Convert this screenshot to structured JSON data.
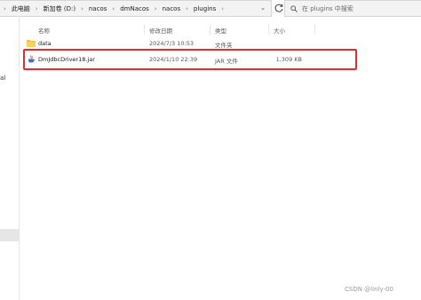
{
  "breadcrumb": [
    "此电脑",
    "新加卷 (D:)",
    "nacos",
    "dmNacos",
    "nacos",
    "plugins"
  ],
  "search": {
    "placeholder": "在 plugins 中搜索"
  },
  "left_pane_label": "al",
  "columns": {
    "name": "名称",
    "date": "修改日期",
    "type": "类型",
    "size": "大小"
  },
  "rows": [
    {
      "name": "data",
      "date": "2024/7/3 10:53",
      "type": "文件夹",
      "size": "",
      "icon": "folder-icon"
    },
    {
      "name": "DmJdbcDriver18.jar",
      "date": "2024/1/10 22:39",
      "type": "JAR 文件",
      "size": "1,309 KB",
      "icon": "jar-file-icon"
    }
  ],
  "colors": {
    "highlight": "#e32c2c",
    "folder": "#f4c13a"
  },
  "watermark": "CSDN @linly-00"
}
